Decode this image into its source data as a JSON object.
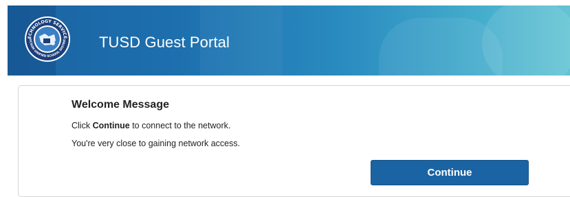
{
  "header": {
    "title": "TUSD Guest Portal",
    "logo_icon": "tusd-technology-services-seal-icon",
    "logo_text_top": "TECHNOLOGY SERVICES",
    "logo_text_bottom": "TUCSON UNIFIED SCHOOL DISTRICT",
    "colors": {
      "banner_start": "#1b64a3",
      "banner_end": "#62c4d3"
    }
  },
  "welcome": {
    "title": "Welcome Message",
    "line1_prefix": "Click ",
    "line1_bold": "Continue",
    "line1_suffix": " to connect to the network.",
    "line2": "You're very close to gaining network access."
  },
  "actions": {
    "continue_label": "Continue",
    "button_color": "#1b64a3"
  }
}
